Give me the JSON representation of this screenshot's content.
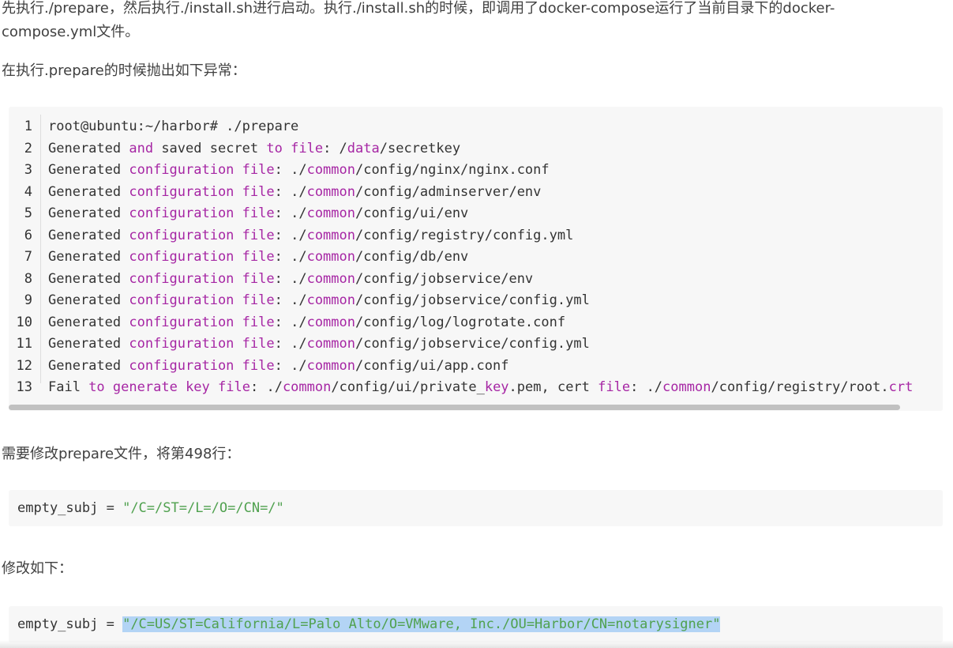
{
  "paragraphs": {
    "intro_line1": "先执行./prepare，然后执行./install.sh进行启动。执行./install.sh的时候，即调用了docker-compose运行了当前目录下的docker-",
    "intro_line2": "compose.yml文件。",
    "exception_intro": "在执行.prepare的时候抛出如下异常：",
    "modify_intro": "需要修改prepare文件，将第498行：",
    "modify_to": "修改如下："
  },
  "code_block": {
    "lines": [
      {
        "num": "1",
        "tokens": [
          {
            "t": "root@ubuntu:~/harbor# ./prepare",
            "c": ""
          }
        ]
      },
      {
        "num": "2",
        "tokens": [
          {
            "t": "Generated ",
            "c": ""
          },
          {
            "t": "and",
            "c": "kw"
          },
          {
            "t": " saved secret ",
            "c": ""
          },
          {
            "t": "to",
            "c": "kw"
          },
          {
            "t": " ",
            "c": ""
          },
          {
            "t": "file",
            "c": "kw"
          },
          {
            "t": ": /",
            "c": ""
          },
          {
            "t": "data",
            "c": "kw"
          },
          {
            "t": "/secretkey",
            "c": ""
          }
        ]
      },
      {
        "num": "3",
        "tokens": [
          {
            "t": "Generated ",
            "c": ""
          },
          {
            "t": "configuration",
            "c": "kw"
          },
          {
            "t": " ",
            "c": ""
          },
          {
            "t": "file",
            "c": "kw"
          },
          {
            "t": ": ./",
            "c": ""
          },
          {
            "t": "common",
            "c": "kw"
          },
          {
            "t": "/config/nginx/nginx.conf",
            "c": ""
          }
        ]
      },
      {
        "num": "4",
        "tokens": [
          {
            "t": "Generated ",
            "c": ""
          },
          {
            "t": "configuration",
            "c": "kw"
          },
          {
            "t": " ",
            "c": ""
          },
          {
            "t": "file",
            "c": "kw"
          },
          {
            "t": ": ./",
            "c": ""
          },
          {
            "t": "common",
            "c": "kw"
          },
          {
            "t": "/config/adminserver/env",
            "c": ""
          }
        ]
      },
      {
        "num": "5",
        "tokens": [
          {
            "t": "Generated ",
            "c": ""
          },
          {
            "t": "configuration",
            "c": "kw"
          },
          {
            "t": " ",
            "c": ""
          },
          {
            "t": "file",
            "c": "kw"
          },
          {
            "t": ": ./",
            "c": ""
          },
          {
            "t": "common",
            "c": "kw"
          },
          {
            "t": "/config/ui/env",
            "c": ""
          }
        ]
      },
      {
        "num": "6",
        "tokens": [
          {
            "t": "Generated ",
            "c": ""
          },
          {
            "t": "configuration",
            "c": "kw"
          },
          {
            "t": " ",
            "c": ""
          },
          {
            "t": "file",
            "c": "kw"
          },
          {
            "t": ": ./",
            "c": ""
          },
          {
            "t": "common",
            "c": "kw"
          },
          {
            "t": "/config/registry/config.yml",
            "c": ""
          }
        ]
      },
      {
        "num": "7",
        "tokens": [
          {
            "t": "Generated ",
            "c": ""
          },
          {
            "t": "configuration",
            "c": "kw"
          },
          {
            "t": " ",
            "c": ""
          },
          {
            "t": "file",
            "c": "kw"
          },
          {
            "t": ": ./",
            "c": ""
          },
          {
            "t": "common",
            "c": "kw"
          },
          {
            "t": "/config/db/env",
            "c": ""
          }
        ]
      },
      {
        "num": "8",
        "tokens": [
          {
            "t": "Generated ",
            "c": ""
          },
          {
            "t": "configuration",
            "c": "kw"
          },
          {
            "t": " ",
            "c": ""
          },
          {
            "t": "file",
            "c": "kw"
          },
          {
            "t": ": ./",
            "c": ""
          },
          {
            "t": "common",
            "c": "kw"
          },
          {
            "t": "/config/jobservice/env",
            "c": ""
          }
        ]
      },
      {
        "num": "9",
        "tokens": [
          {
            "t": "Generated ",
            "c": ""
          },
          {
            "t": "configuration",
            "c": "kw"
          },
          {
            "t": " ",
            "c": ""
          },
          {
            "t": "file",
            "c": "kw"
          },
          {
            "t": ": ./",
            "c": ""
          },
          {
            "t": "common",
            "c": "kw"
          },
          {
            "t": "/config/jobservice/config.yml",
            "c": ""
          }
        ]
      },
      {
        "num": "10",
        "tokens": [
          {
            "t": "Generated ",
            "c": ""
          },
          {
            "t": "configuration",
            "c": "kw"
          },
          {
            "t": " ",
            "c": ""
          },
          {
            "t": "file",
            "c": "kw"
          },
          {
            "t": ": ./",
            "c": ""
          },
          {
            "t": "common",
            "c": "kw"
          },
          {
            "t": "/config/log/logrotate.conf",
            "c": ""
          }
        ]
      },
      {
        "num": "11",
        "tokens": [
          {
            "t": "Generated ",
            "c": ""
          },
          {
            "t": "configuration",
            "c": "kw"
          },
          {
            "t": " ",
            "c": ""
          },
          {
            "t": "file",
            "c": "kw"
          },
          {
            "t": ": ./",
            "c": ""
          },
          {
            "t": "common",
            "c": "kw"
          },
          {
            "t": "/config/jobservice/config.yml",
            "c": ""
          }
        ]
      },
      {
        "num": "12",
        "tokens": [
          {
            "t": "Generated ",
            "c": ""
          },
          {
            "t": "configuration",
            "c": "kw"
          },
          {
            "t": " ",
            "c": ""
          },
          {
            "t": "file",
            "c": "kw"
          },
          {
            "t": ": ./",
            "c": ""
          },
          {
            "t": "common",
            "c": "kw"
          },
          {
            "t": "/config/ui/app.conf",
            "c": ""
          }
        ]
      },
      {
        "num": "13",
        "tokens": [
          {
            "t": "Fail ",
            "c": ""
          },
          {
            "t": "to",
            "c": "kw"
          },
          {
            "t": " ",
            "c": ""
          },
          {
            "t": "generate",
            "c": "kw"
          },
          {
            "t": " ",
            "c": ""
          },
          {
            "t": "key",
            "c": "kw"
          },
          {
            "t": " ",
            "c": ""
          },
          {
            "t": "file",
            "c": "kw"
          },
          {
            "t": ": ./",
            "c": ""
          },
          {
            "t": "common",
            "c": "kw"
          },
          {
            "t": "/config/ui/private_",
            "c": ""
          },
          {
            "t": "key",
            "c": "kw"
          },
          {
            "t": ".pem, cert ",
            "c": ""
          },
          {
            "t": "file",
            "c": "kw"
          },
          {
            "t": ": ./",
            "c": ""
          },
          {
            "t": "common",
            "c": "kw"
          },
          {
            "t": "/config/registry/root.",
            "c": ""
          },
          {
            "t": "crt",
            "c": "kw"
          }
        ]
      }
    ]
  },
  "snippet_old": {
    "var": "empty_subj",
    "op": " = ",
    "value": "\"/C=/ST=/L=/O=/CN=/\""
  },
  "snippet_new": {
    "var": "empty_subj",
    "op": " = ",
    "value": "\"/C=US/ST=California/L=Palo Alto/O=VMware, Inc./OU=Harbor/CN=notarysigner\""
  },
  "colors": {
    "keyword": "#a626a4",
    "string": "#50a14f",
    "code_bg": "#f7f7f7",
    "selection": "#b3d4f5"
  }
}
